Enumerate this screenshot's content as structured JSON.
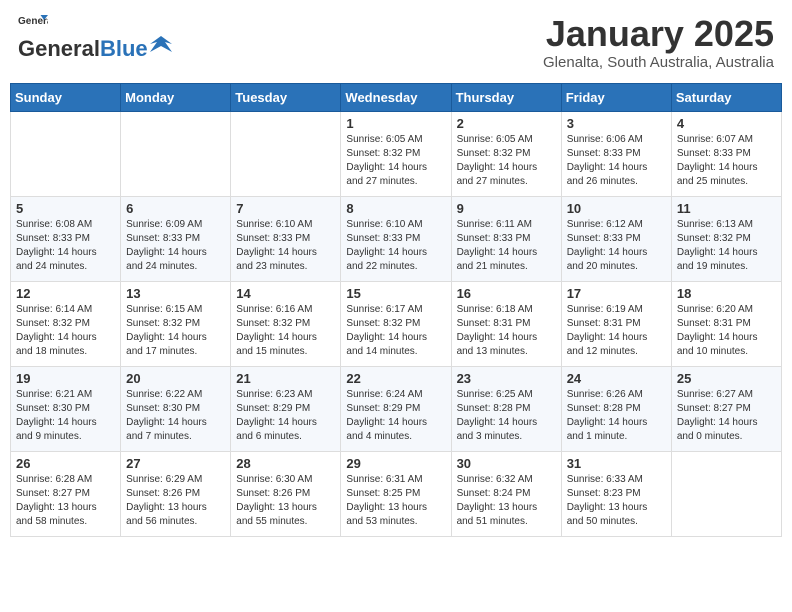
{
  "header": {
    "logo_line1": "General",
    "logo_line2": "Blue",
    "month": "January 2025",
    "location": "Glenalta, South Australia, Australia"
  },
  "weekdays": [
    "Sunday",
    "Monday",
    "Tuesday",
    "Wednesday",
    "Thursday",
    "Friday",
    "Saturday"
  ],
  "weeks": [
    [
      {
        "day": "",
        "info": ""
      },
      {
        "day": "",
        "info": ""
      },
      {
        "day": "",
        "info": ""
      },
      {
        "day": "1",
        "info": "Sunrise: 6:05 AM\nSunset: 8:32 PM\nDaylight: 14 hours\nand 27 minutes."
      },
      {
        "day": "2",
        "info": "Sunrise: 6:05 AM\nSunset: 8:32 PM\nDaylight: 14 hours\nand 27 minutes."
      },
      {
        "day": "3",
        "info": "Sunrise: 6:06 AM\nSunset: 8:33 PM\nDaylight: 14 hours\nand 26 minutes."
      },
      {
        "day": "4",
        "info": "Sunrise: 6:07 AM\nSunset: 8:33 PM\nDaylight: 14 hours\nand 25 minutes."
      }
    ],
    [
      {
        "day": "5",
        "info": "Sunrise: 6:08 AM\nSunset: 8:33 PM\nDaylight: 14 hours\nand 24 minutes."
      },
      {
        "day": "6",
        "info": "Sunrise: 6:09 AM\nSunset: 8:33 PM\nDaylight: 14 hours\nand 24 minutes."
      },
      {
        "day": "7",
        "info": "Sunrise: 6:10 AM\nSunset: 8:33 PM\nDaylight: 14 hours\nand 23 minutes."
      },
      {
        "day": "8",
        "info": "Sunrise: 6:10 AM\nSunset: 8:33 PM\nDaylight: 14 hours\nand 22 minutes."
      },
      {
        "day": "9",
        "info": "Sunrise: 6:11 AM\nSunset: 8:33 PM\nDaylight: 14 hours\nand 21 minutes."
      },
      {
        "day": "10",
        "info": "Sunrise: 6:12 AM\nSunset: 8:33 PM\nDaylight: 14 hours\nand 20 minutes."
      },
      {
        "day": "11",
        "info": "Sunrise: 6:13 AM\nSunset: 8:32 PM\nDaylight: 14 hours\nand 19 minutes."
      }
    ],
    [
      {
        "day": "12",
        "info": "Sunrise: 6:14 AM\nSunset: 8:32 PM\nDaylight: 14 hours\nand 18 minutes."
      },
      {
        "day": "13",
        "info": "Sunrise: 6:15 AM\nSunset: 8:32 PM\nDaylight: 14 hours\nand 17 minutes."
      },
      {
        "day": "14",
        "info": "Sunrise: 6:16 AM\nSunset: 8:32 PM\nDaylight: 14 hours\nand 15 minutes."
      },
      {
        "day": "15",
        "info": "Sunrise: 6:17 AM\nSunset: 8:32 PM\nDaylight: 14 hours\nand 14 minutes."
      },
      {
        "day": "16",
        "info": "Sunrise: 6:18 AM\nSunset: 8:31 PM\nDaylight: 14 hours\nand 13 minutes."
      },
      {
        "day": "17",
        "info": "Sunrise: 6:19 AM\nSunset: 8:31 PM\nDaylight: 14 hours\nand 12 minutes."
      },
      {
        "day": "18",
        "info": "Sunrise: 6:20 AM\nSunset: 8:31 PM\nDaylight: 14 hours\nand 10 minutes."
      }
    ],
    [
      {
        "day": "19",
        "info": "Sunrise: 6:21 AM\nSunset: 8:30 PM\nDaylight: 14 hours\nand 9 minutes."
      },
      {
        "day": "20",
        "info": "Sunrise: 6:22 AM\nSunset: 8:30 PM\nDaylight: 14 hours\nand 7 minutes."
      },
      {
        "day": "21",
        "info": "Sunrise: 6:23 AM\nSunset: 8:29 PM\nDaylight: 14 hours\nand 6 minutes."
      },
      {
        "day": "22",
        "info": "Sunrise: 6:24 AM\nSunset: 8:29 PM\nDaylight: 14 hours\nand 4 minutes."
      },
      {
        "day": "23",
        "info": "Sunrise: 6:25 AM\nSunset: 8:28 PM\nDaylight: 14 hours\nand 3 minutes."
      },
      {
        "day": "24",
        "info": "Sunrise: 6:26 AM\nSunset: 8:28 PM\nDaylight: 14 hours\nand 1 minute."
      },
      {
        "day": "25",
        "info": "Sunrise: 6:27 AM\nSunset: 8:27 PM\nDaylight: 14 hours\nand 0 minutes."
      }
    ],
    [
      {
        "day": "26",
        "info": "Sunrise: 6:28 AM\nSunset: 8:27 PM\nDaylight: 13 hours\nand 58 minutes."
      },
      {
        "day": "27",
        "info": "Sunrise: 6:29 AM\nSunset: 8:26 PM\nDaylight: 13 hours\nand 56 minutes."
      },
      {
        "day": "28",
        "info": "Sunrise: 6:30 AM\nSunset: 8:26 PM\nDaylight: 13 hours\nand 55 minutes."
      },
      {
        "day": "29",
        "info": "Sunrise: 6:31 AM\nSunset: 8:25 PM\nDaylight: 13 hours\nand 53 minutes."
      },
      {
        "day": "30",
        "info": "Sunrise: 6:32 AM\nSunset: 8:24 PM\nDaylight: 13 hours\nand 51 minutes."
      },
      {
        "day": "31",
        "info": "Sunrise: 6:33 AM\nSunset: 8:23 PM\nDaylight: 13 hours\nand 50 minutes."
      },
      {
        "day": "",
        "info": ""
      }
    ]
  ]
}
